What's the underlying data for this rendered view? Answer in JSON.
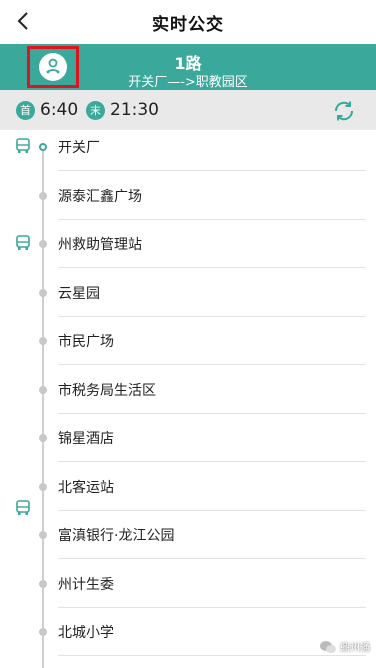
{
  "header": {
    "title": "实时公交"
  },
  "route": {
    "name": "1路",
    "direction": "开关厂—->职教园区"
  },
  "times": {
    "first_badge": "首",
    "first_time": "6:40",
    "last_badge": "末",
    "last_time": "21:30"
  },
  "stops": [
    "开关厂",
    "源泰汇鑫广场",
    "州救助管理站",
    "云星园",
    "市民广场",
    "市税务局生活区",
    "锦星酒店",
    "北客运站",
    "富滇银行·龙江公园",
    "州计生委",
    "北城小学"
  ],
  "watermark": "鼎州通",
  "colors": {
    "accent": "#3aa89a",
    "highlight": "#e0141f",
    "bus_icon": "#3aa89a"
  }
}
